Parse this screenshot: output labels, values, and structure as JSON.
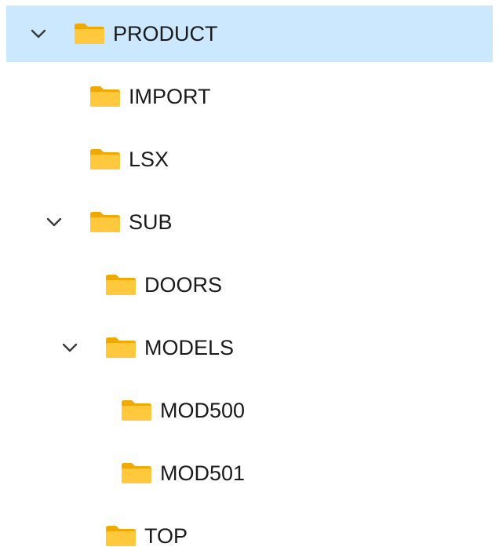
{
  "tree": {
    "items": [
      {
        "label": "PRODUCT",
        "expanded": true,
        "selected": true,
        "level": 0,
        "icon": "folder-icon"
      },
      {
        "label": "IMPORT",
        "level": 1,
        "icon": "folder-icon"
      },
      {
        "label": "LSX",
        "level": 1,
        "icon": "folder-icon"
      },
      {
        "label": "SUB",
        "expanded": true,
        "level": 1,
        "icon": "folder-icon"
      },
      {
        "label": "DOORS",
        "level": 2,
        "icon": "folder-icon"
      },
      {
        "label": "MODELS",
        "expanded": true,
        "level": 2,
        "icon": "folder-icon"
      },
      {
        "label": "MOD500",
        "level": 3,
        "icon": "folder-icon"
      },
      {
        "label": "MOD501",
        "level": 3,
        "icon": "folder-icon"
      },
      {
        "label": "TOP",
        "level": 2,
        "icon": "folder-icon"
      }
    ]
  },
  "colors": {
    "selection": "#cce8ff",
    "folder_body": "#ffc83d",
    "folder_back": "#f0a900",
    "chevron": "#3a3a3a"
  }
}
